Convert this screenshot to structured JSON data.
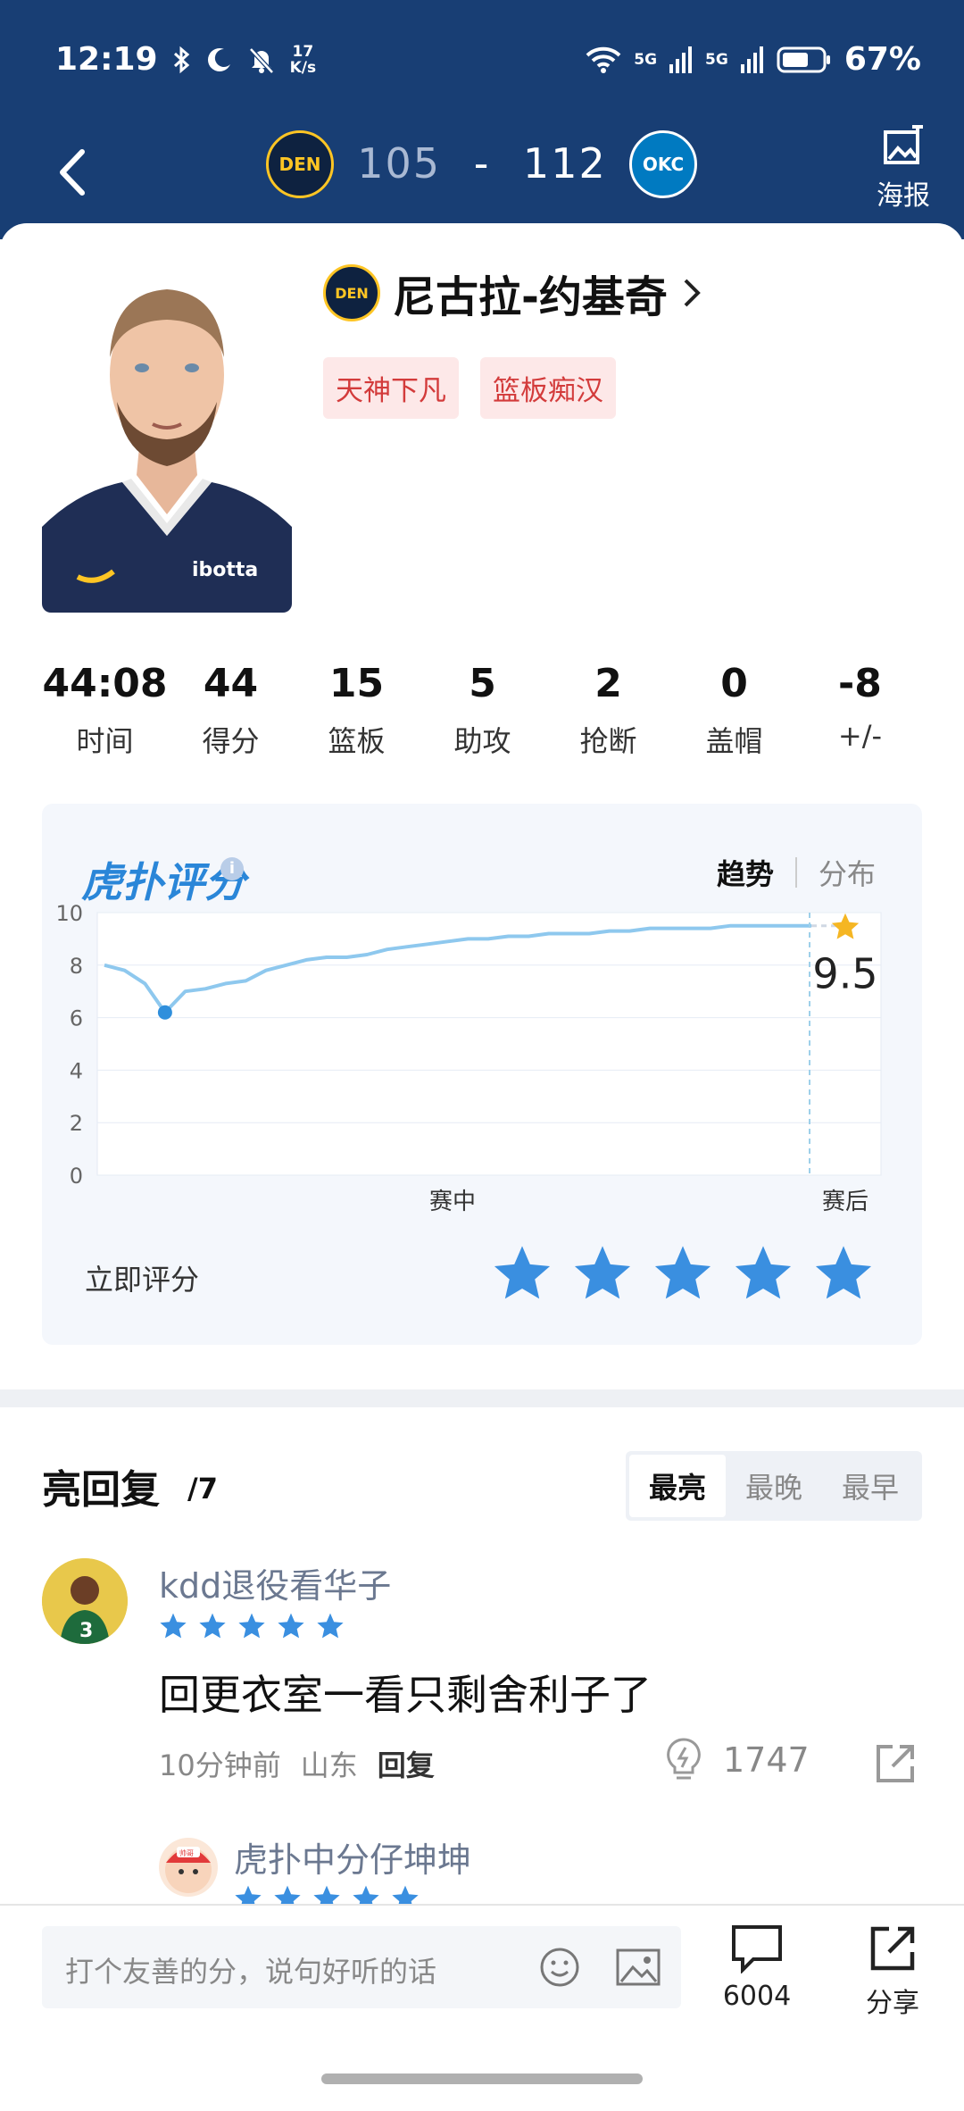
{
  "status_bar": {
    "time": "12:19",
    "net_speed_top": "17",
    "net_speed_bottom": "K/s",
    "signal_1": "5G",
    "signal_2": "5G",
    "battery": "67%"
  },
  "header": {
    "home_team": "DEN",
    "away_team": "OKC",
    "home_score": "105",
    "separator": "-",
    "away_score": "112",
    "poster_label": "海报"
  },
  "player": {
    "team_badge": "DEN",
    "name": "尼古拉-约基奇",
    "tags": [
      "天神下凡",
      "篮板痴汉"
    ],
    "jersey_text": "ibotta"
  },
  "stats": [
    {
      "value": "44:08",
      "label": "时间"
    },
    {
      "value": "44",
      "label": "得分"
    },
    {
      "value": "15",
      "label": "篮板"
    },
    {
      "value": "5",
      "label": "助攻"
    },
    {
      "value": "2",
      "label": "抢断"
    },
    {
      "value": "0",
      "label": "盖帽"
    },
    {
      "value": "-8",
      "label": "+/-"
    }
  ],
  "rating": {
    "logo": "虎扑评分",
    "info": "i",
    "tab_active": "趋势",
    "tab_inactive": "分布",
    "rate_now": "立即评分",
    "star_count": 5
  },
  "chart_data": {
    "type": "line",
    "yticks": [
      "10",
      "8",
      "6",
      "4",
      "2",
      "0"
    ],
    "ylim": [
      0,
      10
    ],
    "x_labels": [
      "赛中",
      "赛后"
    ],
    "series": [
      {
        "values": [
          8.0,
          7.8,
          7.3,
          6.2,
          7.0,
          7.1,
          7.3,
          7.4,
          7.8,
          8.0,
          8.2,
          8.3,
          8.3,
          8.4,
          8.6,
          8.7,
          8.8,
          8.9,
          9.0,
          9.0,
          9.1,
          9.1,
          9.2,
          9.2,
          9.2,
          9.3,
          9.3,
          9.4,
          9.4,
          9.4,
          9.4,
          9.5,
          9.5,
          9.5,
          9.5,
          9.5
        ]
      }
    ],
    "low_point": 6.2,
    "final_value": "9.5"
  },
  "replies": {
    "title": "亮回复",
    "count": "/7",
    "sort_tabs": [
      "最亮",
      "最晚",
      "最早"
    ],
    "comments": [
      {
        "user": "kdd退役看华子",
        "rating": 5,
        "text": "回更衣室一看只剩舍利子了",
        "time": "10分钟前",
        "location": "山东",
        "reply": "回复",
        "likes": "1747",
        "avatar_number": "3"
      },
      {
        "user": "虎扑中分仔坤坤",
        "rating": 5,
        "avatar_text": "帅哥"
      }
    ]
  },
  "bottom_bar": {
    "placeholder": "打个友善的分，说句好听的话",
    "comment_count": "6004",
    "share_label": "分享"
  },
  "colors": {
    "header_bg": "#183e74",
    "accent_blue": "#2a86d8",
    "star_blue": "#3a8fe0",
    "tag_red": "#d33b3b",
    "line_color": "#8ec8ee",
    "gold_star": "#f5b623"
  }
}
